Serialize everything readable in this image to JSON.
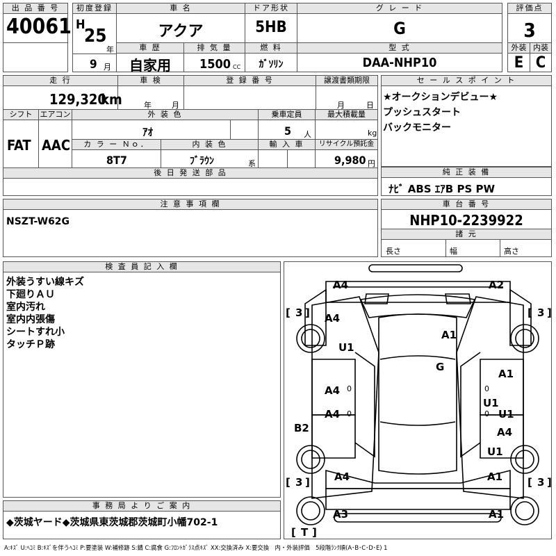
{
  "header": {
    "lot_label": "出 品 番 号",
    "lot": "40061",
    "first_reg_label": "初度登録",
    "era": "H",
    "year": "25",
    "year_unit": "年",
    "month": "9",
    "month_unit": "月",
    "name_label": "車 名",
    "name": "アクア",
    "door_label": "ドア形状",
    "door": "5HB",
    "grade_label": "グ レ ー ド",
    "grade": "G",
    "score_label": "評価点",
    "score": "3",
    "history_label": "車 歴",
    "history": "自家用",
    "displacement_label": "排 気 量",
    "displacement": "1500",
    "cc": "CC",
    "fuel_label": "燃 料",
    "fuel": "ｶﾞｿﾘﾝ",
    "model_label": "型 式",
    "model": "DAA-NHP10",
    "ext_label": "外装",
    "ext": "E",
    "int_label": "内装",
    "int": "C"
  },
  "row2": {
    "mileage_label": "走 行",
    "mileage": "129,320",
    "km": "km",
    "inspection_label": "車 検",
    "insp_year": "年",
    "insp_month": "月",
    "reg_no_label": "登 録 番 号",
    "transfer_label": "譲渡書類期限",
    "trans_month": "月",
    "trans_day": "日",
    "shift_label": "シフト",
    "shift": "FAT",
    "ac_label": "エアコン",
    "ac": "AAC",
    "color_label": "外 装 色",
    "color": "ｱｵ",
    "capacity_label": "乗車定員",
    "capacity": "5",
    "capacity_unit": "人",
    "load_label": "最大積載量",
    "load_unit": "kg",
    "color_no_label": "カ ラ ー Ｎｏ．",
    "color_no": "8T7",
    "int_color_label": "内 装 色",
    "int_color": "ﾌﾞﾗｳﾝ",
    "int_color_unit": "系",
    "import_label": "輸 入 車",
    "recycle_label": "リサイクル預託金",
    "recycle": "9,980",
    "recycle_unit": "円",
    "later_label": "後 日 発 送 部 品"
  },
  "sales_points": {
    "label": "セ ー ル ス ポ イ ン ト",
    "items": [
      "★オークションデビュー★",
      "プッシュスタート",
      "バックモニター"
    ]
  },
  "equipment": {
    "label": "純 正 装 備",
    "value": "ﾅﾋﾞ ABS ｴｱB PS PW"
  },
  "notes": {
    "label": "注 意 事 項 欄",
    "value": "NSZT-W62G"
  },
  "chassis": {
    "label": "車 台 番 号",
    "value": "NHP10-2239922",
    "dims_label": "諸 元",
    "length": "長さ",
    "width": "幅",
    "height": "高さ"
  },
  "inspector": {
    "label": "検 査 員 記 入 欄",
    "items": [
      "外装うすい線キズ",
      "下廻りＡＵ",
      "室内汚れ",
      "室内内張傷",
      "シートすれ小",
      "タッチＰ跡"
    ]
  },
  "office": {
    "label": "事 務 局 よ り ご 案 内",
    "value": "◆茨城ヤード◆茨城県東茨城郡茨城町小幡702-1"
  },
  "diagram": {
    "marks": {
      "a4_front_left": "A4",
      "a2_front_right": "A2",
      "a4_fender_left": "A4",
      "u1_left": "U1",
      "a1_roof": "A1",
      "g_windshield": "G",
      "a1_right_door": "A1",
      "u1_right_a": "U1",
      "u1_right_b": "U1",
      "a4_right": "A4",
      "u1_right_c": "U1",
      "a4_left_door1": "A4",
      "a4_left_door2": "A4",
      "b2_left": "B2",
      "a4_rear_left": "A4",
      "a1_rear_right": "A1",
      "a3_bumper": "A3",
      "a1_bumper": "A1",
      "d1": "0",
      "d2": "0",
      "d3": "0",
      "d4": "0"
    },
    "tires": {
      "fl": "3",
      "fr": "3",
      "rl": "3",
      "rr": "3",
      "t": "T"
    }
  },
  "legend": "A:ｷｽﾞ U:ﾍｺﾐ B:ｷｽﾞを伴うﾍｺﾐ P:要塗装 W:補修跡 S:錆 C:腐食 G:ﾌﾛﾝﾄｶﾞﾗｽ点ｷｽﾞ XX:交換済み X:要交換　内・外装評価　5段階ﾗﾝｸ順(A･B･C･D･E) 1"
}
